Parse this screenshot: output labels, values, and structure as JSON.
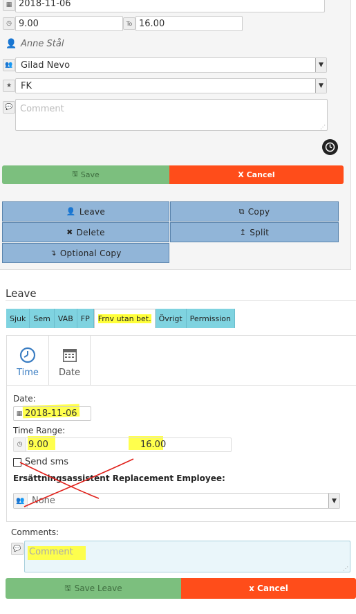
{
  "top": {
    "date_value": "2018-11-06",
    "time_from": "9.00",
    "time_to_label": "To",
    "time_to": "16.00",
    "person": "Anne Stål",
    "employee_select": "Gilad Nevo",
    "category_select": "FK",
    "comment_placeholder": "Comment",
    "save_label": "Save",
    "cancel_label": "X Cancel"
  },
  "actions": {
    "leave": "Leave",
    "copy": "Copy",
    "delete": "Delete",
    "split": "Split",
    "optional_copy": "Optional Copy"
  },
  "leave_section": {
    "title": "Leave",
    "tabs": [
      "Sjuk",
      "Sem",
      "VAB",
      "FP",
      "Frnv utan bet.",
      "Övrigt",
      "Permission"
    ],
    "active_tab_index": 4,
    "mode_tabs": [
      {
        "label": "Time",
        "icon": "clock-icon",
        "color": "#3a7dc2"
      },
      {
        "label": "Date",
        "icon": "calendar-icon",
        "color": "#555555"
      }
    ],
    "date_label": "Date:",
    "date_value": "2018-11-06",
    "time_range_label": "Time Range:",
    "time_from": "9.00",
    "time_to": "16.00",
    "send_sms_label": "Send sms",
    "replacement_label": "Ersättningsassistent Replacement Employee:",
    "replacement_select": "None",
    "comments_label": "Comments:",
    "comment_placeholder": "Comment",
    "save_label": "Save Leave",
    "cancel_label": "x Cancel"
  },
  "colors": {
    "save_green": "#7cbf7e",
    "cancel_orange": "#ff4d1a",
    "action_blue": "#91b5d8",
    "tab_cyan": "#7fd3e0",
    "highlight_yellow": "#ffff3a",
    "annotation_red": "#e0201a"
  }
}
